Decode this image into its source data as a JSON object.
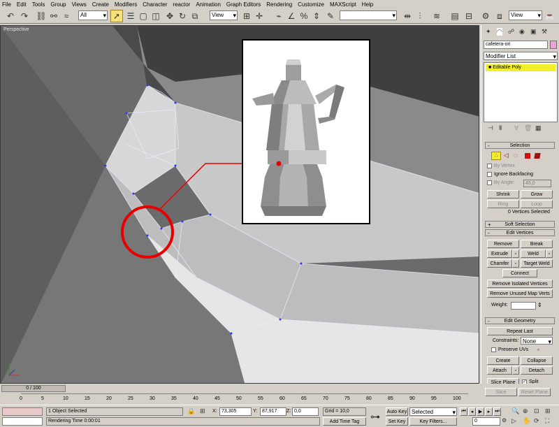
{
  "menu": [
    "File",
    "Edit",
    "Tools",
    "Group",
    "Views",
    "Create",
    "Modifiers",
    "Character",
    "reactor",
    "Animation",
    "Graph Editors",
    "Rendering",
    "Customize",
    "MAXScript",
    "Help"
  ],
  "toolbar": {
    "selection_filter": "All",
    "ref_coord": "View",
    "named_selection": "",
    "view_dropdown": "View",
    "icons": [
      "undo-icon",
      "redo-icon",
      "link-icon",
      "unlink-icon",
      "bind-icon",
      "select-object-icon",
      "select-by-name-icon",
      "rect-region-icon",
      "window-crossing-icon",
      "select-move-icon",
      "select-rotate-icon",
      "select-scale-icon",
      "select-manipulate-icon",
      "snap-icon",
      "angle-snap-icon",
      "percent-snap-icon",
      "spinner-snap-icon",
      "mirror-icon",
      "align-icon",
      "layer-icon",
      "curve-editor-icon",
      "schematic-icon",
      "material-editor-icon",
      "render-setup-icon",
      "quick-render-icon"
    ]
  },
  "viewport": {
    "label": "Perspective",
    "highlight_color": "#e60000"
  },
  "panel": {
    "object_name": "cafetera-ori",
    "object_color": "#e6a7d4",
    "modifier_list": "Modifier List",
    "stack_item": "Editable Poly",
    "stack_highlight": "#f2ee2a",
    "selection": {
      "title": "Selection",
      "by_vertex": "By Vertex",
      "ignore_backfacing": "Ignore Backfacing",
      "by_angle": "By Angle:",
      "by_angle_value": "45,0",
      "shrink": "Shrink",
      "grow": "Grow",
      "ring": "Ring",
      "loop": "Loop",
      "status": "0 Vertices Selected"
    },
    "soft_selection": {
      "title": "Soft Selection",
      "sign": "+"
    },
    "edit_vertices": {
      "title": "Edit Vertices",
      "sign": "-",
      "remove": "Remove",
      "break": "Break",
      "extrude": "Extrude",
      "weld": "Weld",
      "chamfer": "Chamfer",
      "target_weld": "Target Weld",
      "connect": "Connect",
      "remove_isolated": "Remove Isolated Vertices",
      "remove_unused": "Remove Unused Map Verts",
      "weight_label": "Weight:"
    },
    "edit_geometry": {
      "title": "Edit Geometry",
      "sign": "-",
      "repeat_last": "Repeat Last",
      "constraints_label": "Constraints:",
      "constraints_value": "None",
      "preserve_uvs": "Preserve UVs",
      "create": "Create",
      "collapse": "Collapse",
      "attach": "Attach",
      "detach": "Detach",
      "slice_plane": "Slice Plane",
      "split": "Split",
      "slice": "Slice",
      "reset_plane": "Reset Plane"
    }
  },
  "timeline": {
    "frame": "0 / 100",
    "ticks": [
      "0",
      "5",
      "10",
      "15",
      "20",
      "25",
      "30",
      "35",
      "40",
      "45",
      "50",
      "55",
      "60",
      "65",
      "70",
      "75",
      "80",
      "85",
      "90",
      "95",
      "100"
    ]
  },
  "status": {
    "selected": "1 Object Selected",
    "render_time": "Rendering Time  0:00:01",
    "x_label": "X:",
    "x_value": "73,305",
    "y_label": "Y:",
    "y_value": "87,917",
    "z_label": "Z:",
    "z_value": "0,0",
    "grid": "Grid = 10,0",
    "add_time_tag": "Add Time Tag",
    "auto_key": "Auto Key",
    "set_key": "Set Key",
    "key_mode": "Selected",
    "key_filters": "Key Filters...",
    "current_frame": "0"
  }
}
